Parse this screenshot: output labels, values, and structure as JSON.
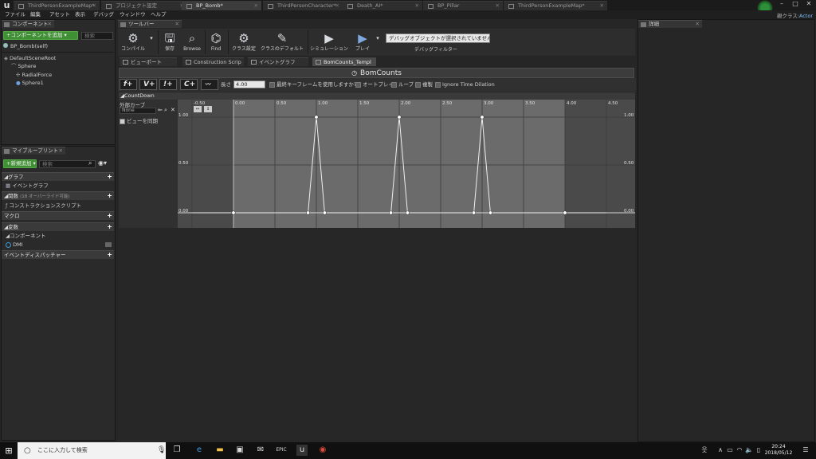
{
  "doc_tabs": [
    {
      "label": "ThirdPersonExampleMap*",
      "active": false
    },
    {
      "label": "プロジェクト設定",
      "active": false
    },
    {
      "label": "BP_Bomb*",
      "active": true
    },
    {
      "label": "ThirdPersonCharacter*",
      "active": false
    },
    {
      "label": "Death_AI*",
      "active": false
    },
    {
      "label": "BP_Pillar",
      "active": false
    },
    {
      "label": "ThirdPersonExampleMap*",
      "active": false
    }
  ],
  "menu": [
    "ファイル",
    "編集",
    "アセット",
    "表示",
    "デバッグ",
    "ウィンドウ",
    "ヘルプ"
  ],
  "parent_class_label": "親クラス:",
  "parent_class_value": "Actor",
  "components_panel": {
    "tab": "コンポーネント",
    "add_button": "+コンポーネントを追加 ▾",
    "search_placeholder": "検索",
    "self_label": "BP_Bomb(self)",
    "tree": [
      "DefaultSceneRoot",
      "Sphere",
      "RadialForce",
      "Sphere1"
    ]
  },
  "myblueprint_panel": {
    "tab": "マイブループリント",
    "new_button": "+新規追加 ▾",
    "search_placeholder": "検索",
    "graph_cat": "グラフ",
    "event_graph": "イベントグラフ",
    "functions_cat": "関数",
    "functions_note": "(18 オーバーライド可能)",
    "construction_script": "コンストラクションスクリプト",
    "macros_cat": "マクロ",
    "variables_cat": "変数",
    "components_cat": "コンポーネント",
    "dmi": "DMI",
    "dispatchers_cat": "イベントディスパッチャー"
  },
  "toolbar": {
    "tab": "ツールバー",
    "compile": "コンパイル",
    "save": "保存",
    "browse": "Browse",
    "find": "Find",
    "class_settings": "クラス設定",
    "class_defaults": "クラスのデフォルト",
    "simulation": "シミュレーション",
    "play": "プレイ",
    "debug_dropdown": "デバッグオブジェクトが選択されていません ▾",
    "debug_filter": "デバッグフィルター"
  },
  "subtabs": [
    {
      "label": "ビューポート",
      "active": false
    },
    {
      "label": "Construction Scrip",
      "active": false
    },
    {
      "label": "イベントグラフ",
      "active": false
    },
    {
      "label": "BomCounts_Templ",
      "active": true
    }
  ],
  "details_tab": "詳細",
  "timeline": {
    "title": "BomCounts",
    "btn_float": "f+",
    "btn_vector": "V+",
    "btn_event": "!+",
    "btn_color": "C+",
    "length_label": "長さ",
    "length_value": "4.00",
    "opt_last_keyframe": "最終キーフレームを使用しますか?",
    "opt_autoplay": "オートプレイ",
    "opt_loop": "ループ",
    "opt_replicated": "複製",
    "opt_ignore_dilation": "Ignore Time Dilation",
    "track_name": "CountDown",
    "external_curve_label": "外部カーブ",
    "external_curve_value": "None",
    "sync_view": "ビューを同期"
  },
  "chart_data": {
    "type": "line",
    "series": [
      {
        "x": [
          -0.5,
          0.0,
          0.9,
          1.0,
          1.1,
          1.9,
          2.0,
          2.1,
          2.9,
          3.0,
          3.1,
          4.0,
          4.5
        ],
        "y": [
          0,
          0,
          0,
          1,
          0,
          0,
          1,
          0,
          0,
          1,
          0,
          0,
          0
        ]
      }
    ],
    "keys": [
      {
        "x": 0.0,
        "y": 0
      },
      {
        "x": 0.9,
        "y": 0
      },
      {
        "x": 1.0,
        "y": 1
      },
      {
        "x": 1.1,
        "y": 0
      },
      {
        "x": 1.9,
        "y": 0
      },
      {
        "x": 2.0,
        "y": 1
      },
      {
        "x": 2.1,
        "y": 0
      },
      {
        "x": 2.9,
        "y": 0
      },
      {
        "x": 3.0,
        "y": 1
      },
      {
        "x": 3.1,
        "y": 0
      },
      {
        "x": 4.0,
        "y": 0
      }
    ],
    "x_ticks": [
      "-0.50",
      "0.00",
      "0.50",
      "1.00",
      "1.50",
      "2.00",
      "2.50",
      "3.00",
      "3.50",
      "4.00",
      "4.50"
    ],
    "y_ticks": [
      "0.00",
      "0.50",
      "1.00"
    ],
    "xlim": [
      -0.5,
      4.5
    ],
    "ylim": [
      0,
      1
    ],
    "active_range": [
      0,
      4
    ]
  },
  "taskbar": {
    "search_placeholder": "ここに入力して検索",
    "time": "20:24",
    "date": "2018/05/12"
  }
}
